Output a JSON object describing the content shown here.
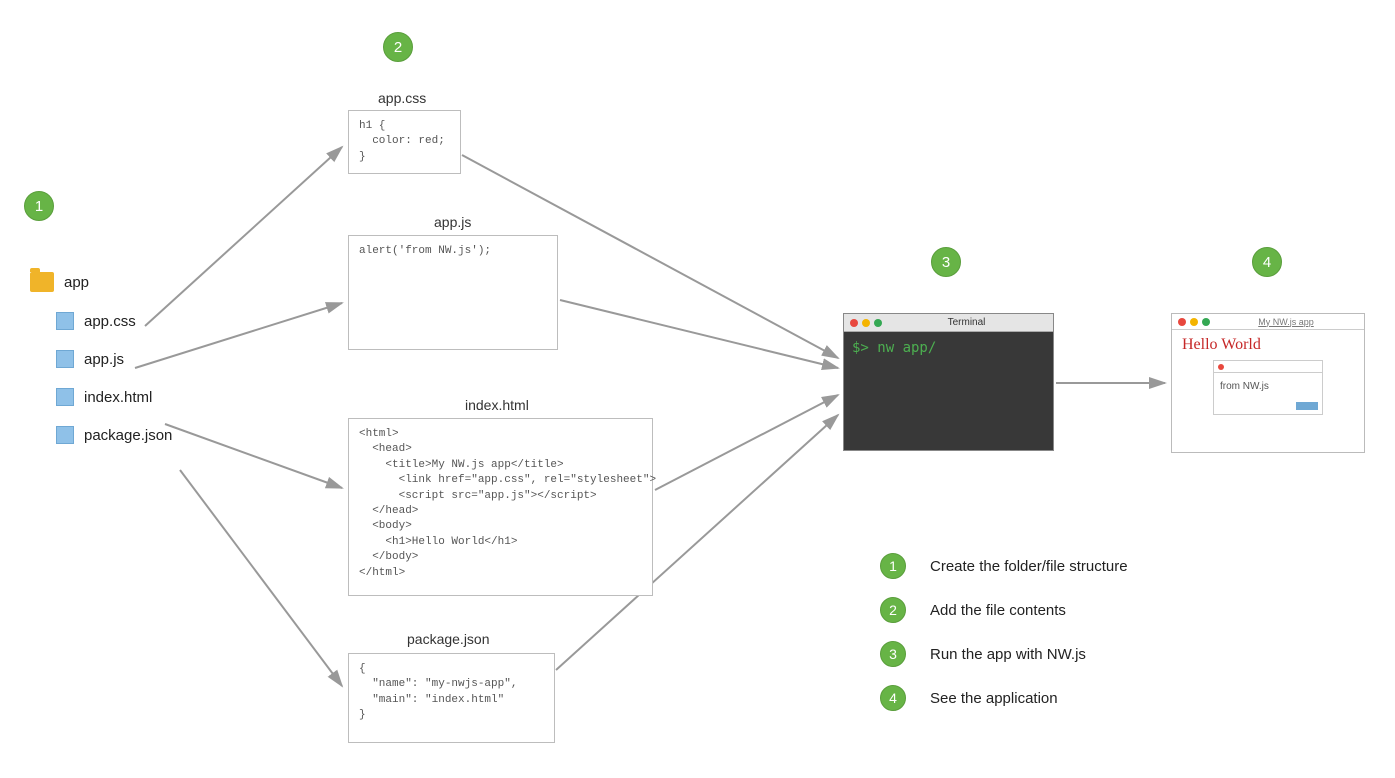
{
  "badges": {
    "n1": "1",
    "n2": "2",
    "n3": "3",
    "n4": "4"
  },
  "tree": {
    "folder": "app",
    "f1": "app.css",
    "f2": "app.js",
    "f3": "index.html",
    "f4": "package.json"
  },
  "box_titles": {
    "css": "app.css",
    "js": "app.js",
    "html": "index.html",
    "json": "package.json"
  },
  "code": {
    "css": "h1 {\n  color: red;\n}",
    "js": "alert('from NW.js');",
    "html": "<html>\n  <head>\n    <title>My NW.js app</title>\n      <link href=\"app.css\", rel=\"stylesheet\">\n      <script src=\"app.js\"></script>\n  </head>\n  <body>\n    <h1>Hello World</h1>\n  </body>\n</html>",
    "json": "{\n  \"name\": \"my-nwjs-app\",\n  \"main\": \"index.html\"\n}"
  },
  "terminal": {
    "title": "Terminal",
    "cmd": "$> nw app/"
  },
  "app_window": {
    "title": "My NW.js app",
    "heading": "Hello World",
    "alert_text": "from NW.js"
  },
  "legend": {
    "l1": "Create the folder/file structure",
    "l2": "Add the file contents",
    "l3": "Run the app with NW.js",
    "l4": "See the application"
  }
}
